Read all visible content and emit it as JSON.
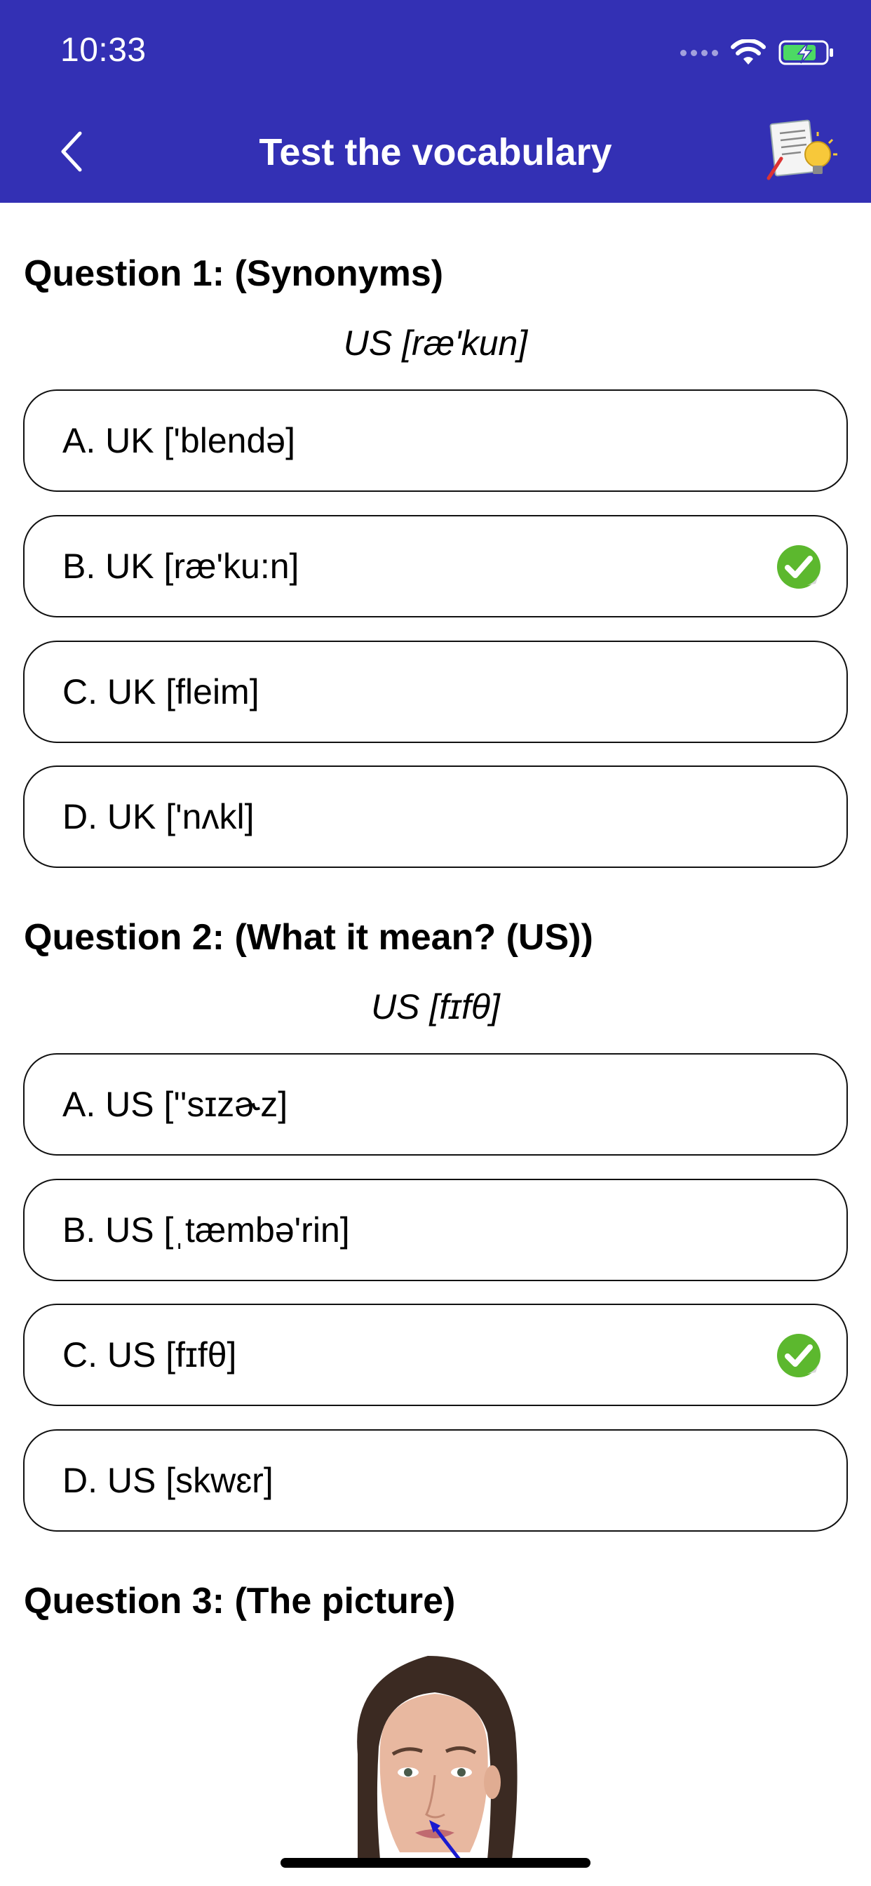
{
  "status_bar": {
    "time": "10:33"
  },
  "header": {
    "title": "Test the vocabulary",
    "background_color": "#3330b4",
    "back_icon": "chevron-left-icon",
    "action_icon": "notes-lightbulb-icon"
  },
  "questions": [
    {
      "title": "Question 1: (Synonyms)",
      "prompt": "US [ræ'kun]",
      "options": [
        {
          "label": "A. UK ['blendə]",
          "correct": false
        },
        {
          "label": "B. UK [ræ'ku:n]",
          "correct": true
        },
        {
          "label": "C. UK [fleim]",
          "correct": false
        },
        {
          "label": "D. UK ['nʌkl]",
          "correct": false
        }
      ]
    },
    {
      "title": "Question 2: (What it mean? (US))",
      "prompt": "US [fɪfθ]",
      "options": [
        {
          "label": "A. US [''sɪzɚz]",
          "correct": false
        },
        {
          "label": "B. US [ˌtæmbə'rin]",
          "correct": false
        },
        {
          "label": "C. US [fɪfθ]",
          "correct": true
        },
        {
          "label": "D. US [skwɛr]",
          "correct": false
        }
      ]
    },
    {
      "title": "Question 3: (The picture)",
      "image": "woman-face-pointing-nose-image"
    }
  ],
  "accent_colors": {
    "check": "#5cb82e"
  }
}
